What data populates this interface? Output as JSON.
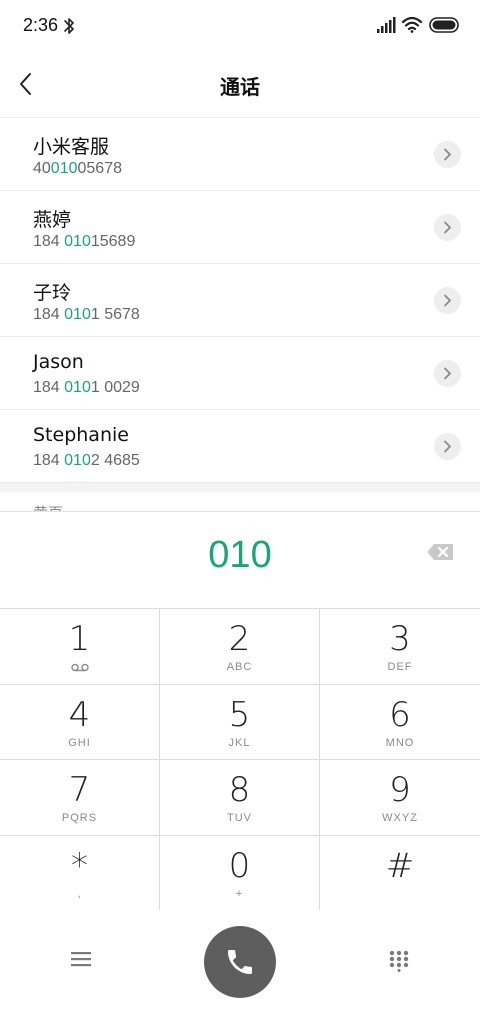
{
  "status_bar": {
    "time": "2:36",
    "icons": [
      "bluetooth-icon",
      "signal-icon",
      "wifi-icon",
      "battery-icon"
    ]
  },
  "header": {
    "title": "通话",
    "back_icon": "back-arrow-icon"
  },
  "contacts": [
    {
      "name": "小米客服",
      "number_pre": "40",
      "number_match": "010",
      "number_post": "05678"
    },
    {
      "name": "燕婷",
      "number_pre": "184 ",
      "number_match": "010",
      "number_post": "15689"
    },
    {
      "name": "子玲",
      "number_pre": "184 ",
      "number_match": "010",
      "number_post": "1 5678"
    },
    {
      "name": "Jason",
      "number_pre": "184 ",
      "number_match": "010",
      "number_post": "1 0029"
    },
    {
      "name": "Stephanie",
      "number_pre": "184 ",
      "number_match": "010",
      "number_post": "2 4685"
    }
  ],
  "section": {
    "label": "黄页"
  },
  "dialer": {
    "number": "010",
    "backspace_icon": "backspace-icon"
  },
  "keypad": [
    {
      "digit": "1",
      "letters": ""
    },
    {
      "digit": "2",
      "letters": "ABC"
    },
    {
      "digit": "3",
      "letters": "DEF"
    },
    {
      "digit": "4",
      "letters": "GHI"
    },
    {
      "digit": "5",
      "letters": "JKL"
    },
    {
      "digit": "6",
      "letters": "MNO"
    },
    {
      "digit": "7",
      "letters": "PQRS"
    },
    {
      "digit": "8",
      "letters": "TUV"
    },
    {
      "digit": "9",
      "letters": "WXYZ"
    },
    {
      "digit": "*",
      "letters": ","
    },
    {
      "digit": "0",
      "letters": "+"
    },
    {
      "digit": "#",
      "letters": ""
    }
  ],
  "bottom_bar": {
    "icons": [
      "menu-icon",
      "phone-icon",
      "dialpad-icon"
    ]
  },
  "colors": {
    "accent": "#1aa672",
    "call_button": "#5e5e5e",
    "divider": "#dcdcdc"
  }
}
